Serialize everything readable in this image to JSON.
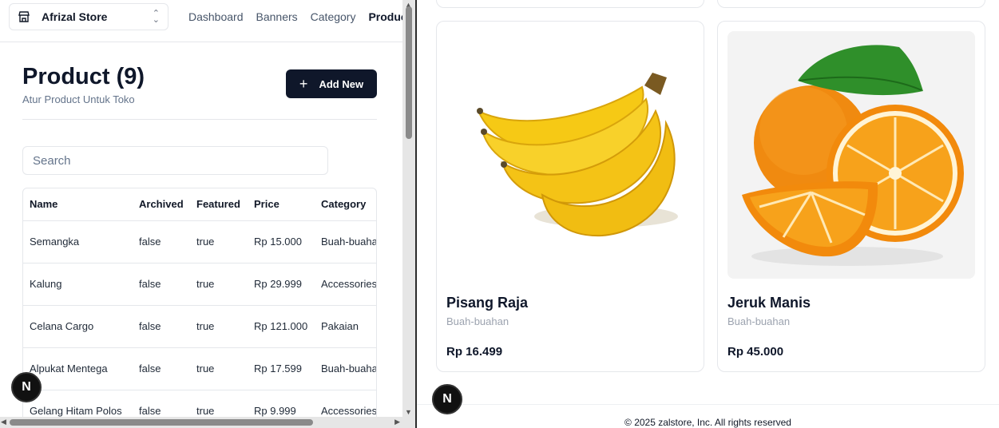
{
  "header": {
    "store_name": "Afrizal Store",
    "nav": [
      "Dashboard",
      "Banners",
      "Category",
      "Products"
    ]
  },
  "page": {
    "title": "Product (9)",
    "subtitle": "Atur Product Untuk Toko",
    "add_label": "Add New",
    "search_placeholder": "Search"
  },
  "table": {
    "columns": [
      "Name",
      "Archived",
      "Featured",
      "Price",
      "Category"
    ],
    "rows": [
      [
        "Semangka",
        "false",
        "true",
        "Rp 15.000",
        "Buah-buahan"
      ],
      [
        "Kalung",
        "false",
        "true",
        "Rp 29.999",
        "Accessories"
      ],
      [
        "Celana Cargo",
        "false",
        "true",
        "Rp 121.000",
        "Pakaian"
      ],
      [
        "Alpukat Mentega",
        "false",
        "true",
        "Rp 17.599",
        "Buah-buahan"
      ],
      [
        "Gelang Hitam Polos",
        "false",
        "true",
        "Rp 9.999",
        "Accessories"
      ]
    ]
  },
  "badge": "N",
  "storefront": {
    "products": [
      {
        "name": "Pisang Raja",
        "category": "Buah-buahan",
        "price": "Rp 16.499",
        "image": "banana-image"
      },
      {
        "name": "Jeruk Manis",
        "category": "Buah-buahan",
        "price": "Rp 45.000",
        "image": "orange-image"
      }
    ],
    "footer": "© 2025 zalstore, Inc. All rights reserved"
  },
  "colors": {
    "primary": "#0f172a",
    "muted": "#64748b",
    "border": "#e5e7eb"
  }
}
